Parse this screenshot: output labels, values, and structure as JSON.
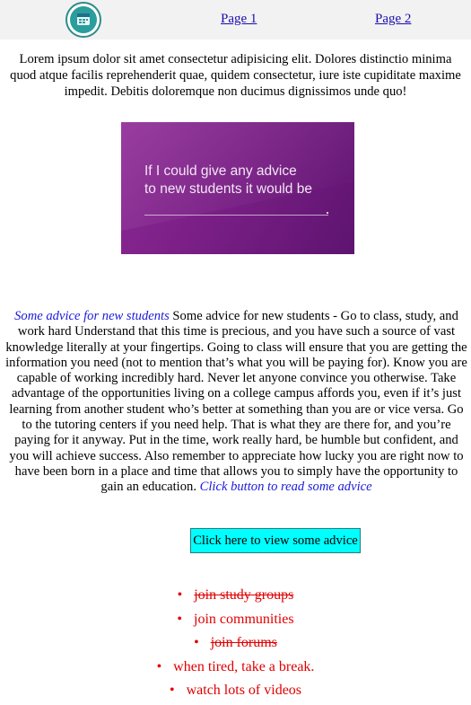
{
  "nav": {
    "logo_icon": "calendar-badge-icon",
    "page1": "Page 1",
    "page2": "Page 2"
  },
  "intro": "Lorem ipsum dolor sit amet consectetur adipisicing elit. Dolores distinctio minima quod atque facilis reprehenderit quae, quidem consectetur, iure iste cupiditate maxime impedit. Debitis doloremque non ducimus dignissimos unde quo!",
  "banner": {
    "line1": "If I could give any advice",
    "line2": "to new students it would be"
  },
  "advice": {
    "lead": "Some advice for new students",
    "body": " Some advice for new students - Go to class, study, and work hard Understand that this time is precious, and you have such a source of vast knowledge literally at your fingertips. Going to class will ensure that you are getting the information you need (not to mention that’s what you will be paying for). Know you are capable of working incredibly hard. Never let anyone convince you otherwise. Take advantage of the opportunities living on a college campus affords you, even if it’s just learning from another student who’s better at something than you are or vice versa. Go to the tutoring centers if you need help. That is what they are there for, and you’re paying for it anyway. Put in the time, work really hard, be humble but confident, and you will achieve success. Also remember to appreciate how lucky you are right now to have been born in a place and time that allows you to simply have the opportunity to gain an education. ",
    "tail": "Click button to read some advice"
  },
  "cta_label": "Click here to view some advice",
  "tips": [
    {
      "text": "join study groups",
      "struck": true
    },
    {
      "text": "join communities",
      "struck": false
    },
    {
      "text": "join forums",
      "struck": true
    },
    {
      "text": "when tired, take a break.",
      "struck": false
    },
    {
      "text": "watch lots of videos",
      "struck": false
    }
  ],
  "colors": {
    "nav_bg": "#f2f2f2",
    "link": "#1a0dab",
    "cta_bg": "#00ffff",
    "tip_text": "#e00000",
    "banner_purple": "#7a1f86"
  }
}
